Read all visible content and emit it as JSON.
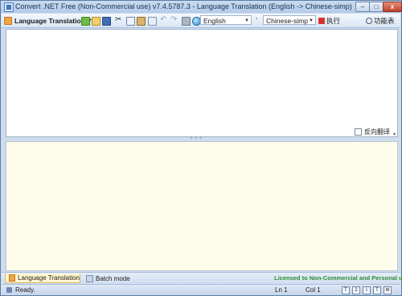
{
  "window": {
    "title": "Convert .NET Free (Non-Commercial use) v7.4.5787.3 - Language Translation (English -> Chinese-simp)",
    "controls": {
      "minimize": "–",
      "maximize": "□",
      "close": "x"
    }
  },
  "toolbar": {
    "mode_label": "Language Translation",
    "source_language": "English",
    "arrow": "›",
    "target_language": "Chinese-simp",
    "execute_label": "执行",
    "functions_label": "功能表"
  },
  "source_pane": {
    "reverse_translate_label": "反向翻译"
  },
  "tabs": [
    {
      "label": "Language Translation",
      "active": true
    },
    {
      "label": "Batch mode",
      "active": false
    }
  ],
  "license_text": "Licensed to Non-Commercial and Personal use",
  "statusbar": {
    "status": "Ready.",
    "line": "Ln 1",
    "col": "Col 1",
    "buttons": [
      "T",
      "2",
      "I",
      "T"
    ]
  },
  "colors": {
    "license_green": "#2f8f2f",
    "target_pane_bg": "#fdfdea",
    "execute_red": "#d6342a"
  }
}
